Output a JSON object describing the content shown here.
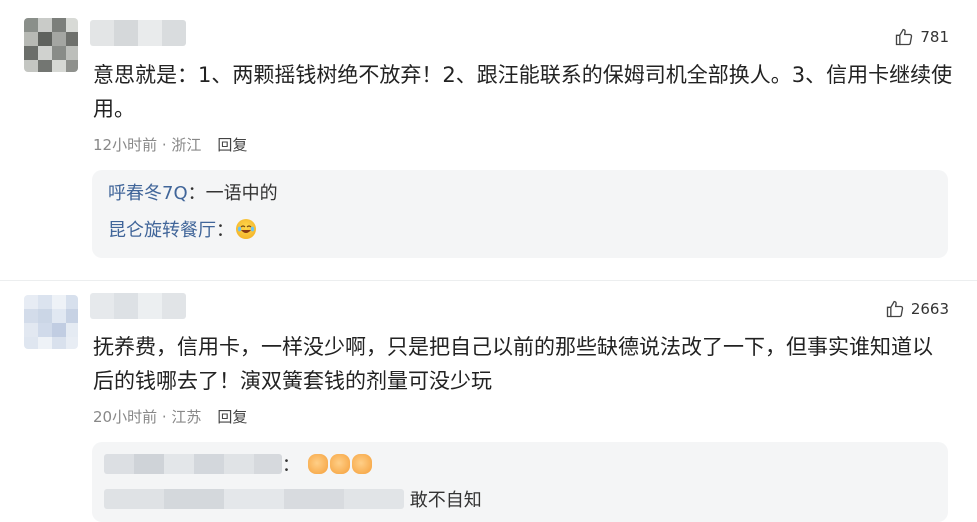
{
  "comments": [
    {
      "likes": "781",
      "text": "意思就是：1、两颗摇钱树绝不放弃！2、跟汪能联系的保姆司机全部换人。3、信用卡继续使用。",
      "time": "12小时前",
      "location": "浙江",
      "reply_label": "回复",
      "replies": [
        {
          "user": "呼春冬7Q",
          "sep": "：",
          "text": "一语中的"
        },
        {
          "user": "昆仑旋转餐厅",
          "sep": "：",
          "emoji": "laughing-crying-face-icon"
        }
      ]
    },
    {
      "likes": "2663",
      "text": "抚养费，信用卡，一样没少啊，只是把自己以前的那些缺德说法改了一下，但事实谁知道以后的钱哪去了！演双簧套钱的剂量可没少玩",
      "time": "20小时前",
      "location": "江苏",
      "reply_label": "回复",
      "replies": [
        {
          "user_blurred": true,
          "sep": "：",
          "emoji_count": 3,
          "emoji": "thumbs-up-icon"
        },
        {
          "user_blurred": true,
          "text": "敢不自知"
        }
      ]
    }
  ],
  "colors": {
    "user_link": "#406599",
    "meta_gray": "#888888",
    "reply_bg": "#f4f5f6"
  }
}
